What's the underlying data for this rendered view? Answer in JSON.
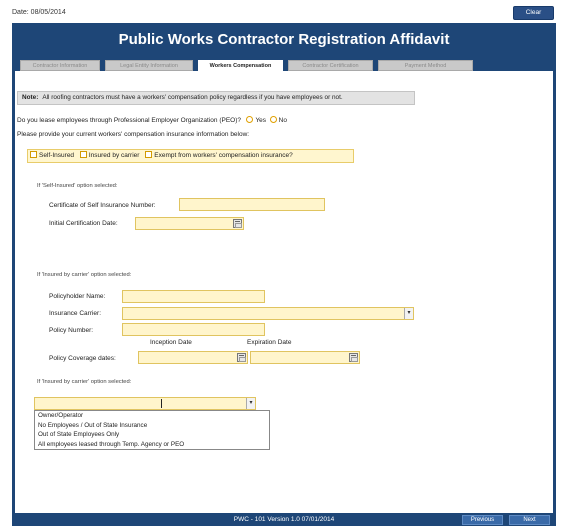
{
  "header": {
    "date_text": "Date: 08/05/2014",
    "clear_label": "Clear"
  },
  "title": "Public Works Contractor Registration Affidavit",
  "tabs": [
    {
      "label": "Contractor Information",
      "active": false
    },
    {
      "label": "Legal Entity Information",
      "active": false
    },
    {
      "label": "Workers Compensation",
      "active": true
    },
    {
      "label": "Contractor Certification",
      "active": false
    },
    {
      "label": "Payment Method",
      "active": false
    }
  ],
  "note": {
    "bold": "Note:",
    "text": "All roofing contractors must have a workers' compensation policy regardless if you have employees or not."
  },
  "peo": {
    "question": "Do you lease employees through Professional Employer Organization (PEO)?",
    "yes": "Yes",
    "no": "No"
  },
  "provide_text": "Please provide your current workers' compensation insurance information below:",
  "options": [
    "Self-Insured",
    "Insured by carrier",
    "Exempt from workers' compensation insurance?"
  ],
  "self_insured": {
    "section_label": "If 'Self-Insured' option selected:",
    "cert_label": "Certificate of Self Insurance Number:",
    "init_label": "Initial Certification Date:"
  },
  "carrier": {
    "section_label": "If 'Insured by carrier' option selected:",
    "holder_label": "Policyholder Name:",
    "carrier_label": "Insurance Carrier:",
    "policy_label": "Policy Number:",
    "inception_label": "Inception Date",
    "expiration_label": "Expiration Date",
    "coverage_label": "Policy Coverage dates:"
  },
  "carrier2": {
    "section_label": "If 'Insured by carrier' option selected:",
    "dropdown_options": [
      "Owner/Operator",
      "No Employees / Out of State Insurance",
      "Out of State Employees Only",
      "All employees leased through Temp. Agency or PEO"
    ]
  },
  "footer": {
    "version": "PWC - 101 Version 1.0 07/01/2014",
    "previous": "Previous",
    "next": "Next"
  },
  "colors": {
    "frame": "#1e4677",
    "field": "#fff5cc",
    "button": "#3a6aa8"
  }
}
